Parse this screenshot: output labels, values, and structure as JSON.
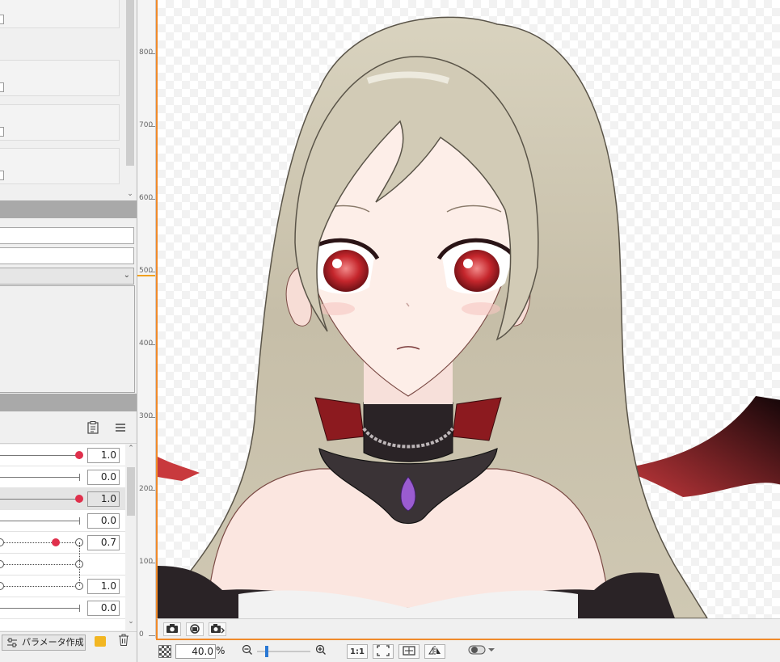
{
  "left_panel": {
    "parameters": [
      {
        "value": "1.0",
        "knob": 1.0,
        "style": "solid",
        "selected": false
      },
      {
        "value": "0.0",
        "knob": null,
        "style": "solid",
        "selected": false
      },
      {
        "value": "1.0",
        "knob": 1.0,
        "style": "solid",
        "selected": true
      },
      {
        "value": "0.0",
        "knob": null,
        "style": "solid",
        "selected": false
      },
      {
        "value": "0.7",
        "knob": 0.7,
        "style": "dotted",
        "selected": false
      },
      {
        "value": "",
        "knob": null,
        "style": "dotted",
        "selected": false
      },
      {
        "value": "1.0",
        "knob": null,
        "style": "dotted",
        "selected": false
      },
      {
        "value": "0.0",
        "knob": null,
        "style": "solid",
        "selected": false
      }
    ],
    "create_param_label": "パラメータ作成"
  },
  "ruler": {
    "labels": [
      "800",
      "700",
      "600",
      "500",
      "400",
      "300",
      "200",
      "100",
      "0"
    ]
  },
  "status_bar": {
    "zoom_value": "40.0",
    "zoom_unit": "%",
    "actual_size_label": "1:1"
  },
  "colors": {
    "accent": "#f08a2a",
    "knob": "#e0304c",
    "slider": "#2a78d4"
  },
  "icons": {
    "capture": [
      "camera-icon",
      "camera-rotate-icon",
      "camera-export-icon"
    ]
  }
}
